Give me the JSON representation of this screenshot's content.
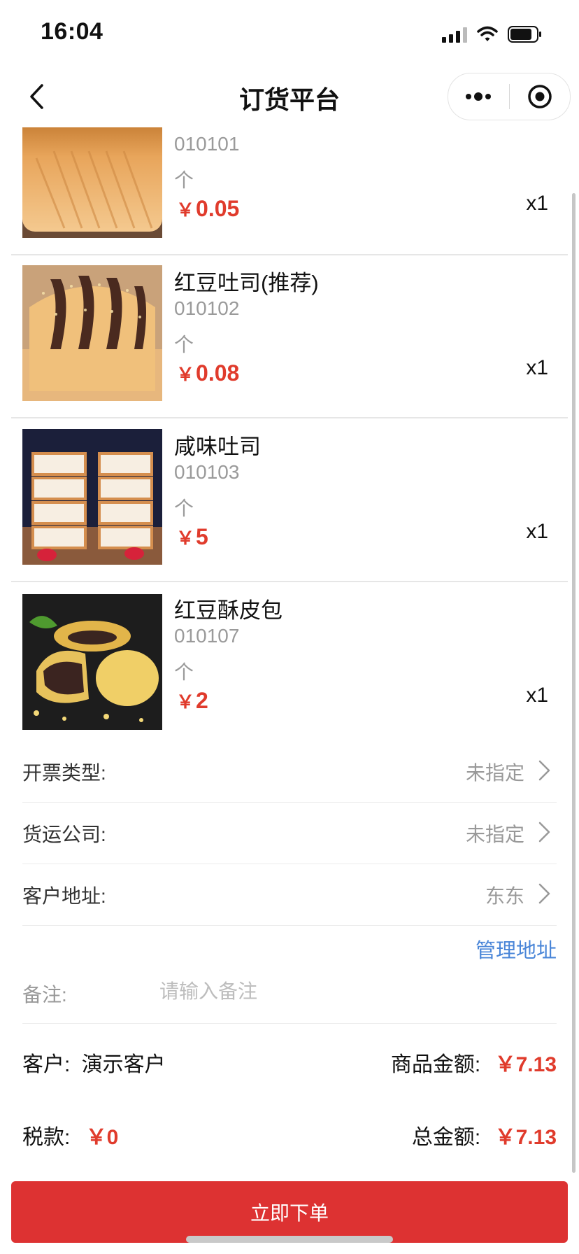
{
  "status_bar": {
    "time": "16:04"
  },
  "nav": {
    "title": "订货平台"
  },
  "products": [
    {
      "name": "",
      "code": "010101",
      "unit": "个",
      "price": "0.05",
      "qty": "x1"
    },
    {
      "name": "红豆吐司(推荐)",
      "code": "010102",
      "unit": "个",
      "price": "0.08",
      "qty": "x1"
    },
    {
      "name": "咸味吐司",
      "code": "010103",
      "unit": "个",
      "price": "5",
      "qty": "x1"
    },
    {
      "name": "红豆酥皮包",
      "code": "010107",
      "unit": "个",
      "price": "2",
      "qty": "x1"
    }
  ],
  "currency_symbol": "￥",
  "form": {
    "invoice_type": {
      "label": "开票类型:",
      "value": "未指定"
    },
    "freight_company": {
      "label": "货运公司:",
      "value": "未指定"
    },
    "customer_address": {
      "label": "客户地址:",
      "value": "东东"
    },
    "manage_address": "管理地址",
    "note": {
      "label": "备注:",
      "placeholder": "请输入备注"
    }
  },
  "summary": {
    "customer_label": "客户:",
    "customer_value": "演示客户",
    "goods_amount_label": "商品金额:",
    "goods_amount_value": "￥7.13",
    "tax_label": "税款:",
    "tax_value": "￥0",
    "total_label": "总金额:",
    "total_value": "￥7.13"
  },
  "submit_label": "立即下单",
  "colors": {
    "accent_red": "#e03b2c",
    "button_red": "#dd3232",
    "link_blue": "#4a86d8"
  }
}
